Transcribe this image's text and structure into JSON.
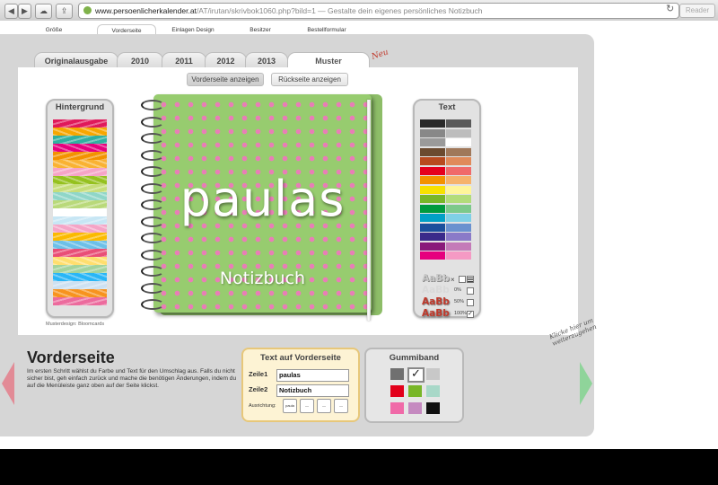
{
  "browser": {
    "url_domain": "www.persoenlicherkalender.at",
    "url_path": "/AT/irutan/skrivbok1060.php?bild=1",
    "title": "— Gestalte dein eigenes persönliches Notizbuch",
    "reader_label": "Reader",
    "reload_glyph": "↻",
    "back_glyph": "◀",
    "forward_glyph": "▶",
    "cloud_glyph": "☁",
    "share_glyph": "⇪"
  },
  "topnav": [
    {
      "label": "Größe"
    },
    {
      "label": "Vorderseite"
    },
    {
      "label": "Einlagen Design"
    },
    {
      "label": "Besitzer"
    },
    {
      "label": "Bestellformular"
    }
  ],
  "year_tabs": [
    {
      "label": "Originalausgabe"
    },
    {
      "label": "2010"
    },
    {
      "label": "2011"
    },
    {
      "label": "2012"
    },
    {
      "label": "2013"
    },
    {
      "label": "Muster"
    }
  ],
  "new_badge": "Neu",
  "view_buttons": {
    "front": "Vorderseite anzeigen",
    "back": "Rückseite anzeigen"
  },
  "background_panel": {
    "title": "Hintergrund",
    "patterns": [
      "#e0195a",
      "#f7a600",
      "#2fb0a0",
      "#e6007e",
      "#f39200",
      "#f9b233",
      "#f5a4c6",
      "#95c11f",
      "#c6dd7a",
      "#8fd6c8",
      "#b9d97a",
      "#ffffff",
      "#c7e6f4",
      "#f5a4c6",
      "#fbba00",
      "#6cc0e8",
      "#e94e77",
      "#ffde6e",
      "#a3d39c",
      "#29b6f6",
      "#cde1f2",
      "#f7931e",
      "#ec6b9d"
    ],
    "credit": "Musterdesign: Bloomcards"
  },
  "notebook": {
    "line1": "paulas",
    "line2": "Notizbuch",
    "background_color": "#97cc6f",
    "dot_color": "#e87eb6",
    "text_color": "#ffffff"
  },
  "text_panel": {
    "title": "Text",
    "colors": [
      [
        "#2a2a2a",
        "#5a5a5a"
      ],
      [
        "#888888",
        "#bdbdbd"
      ],
      [
        "#9a9a9a",
        "#ffffff"
      ],
      [
        "#6b4a2f",
        "#a0785a"
      ],
      [
        "#b84a1f",
        "#e08a5a"
      ],
      [
        "#e5001e",
        "#f06a6a"
      ],
      [
        "#f39200",
        "#f6b26b"
      ],
      [
        "#f7e100",
        "#fff59a"
      ],
      [
        "#78b628",
        "#b2dc7a"
      ],
      [
        "#009a3e",
        "#7cc98a"
      ],
      [
        "#00a0c6",
        "#7fd0e6"
      ],
      [
        "#1b4f9c",
        "#6a91cf"
      ],
      [
        "#3a2a8a",
        "#8a7ac8"
      ],
      [
        "#8a1a7a",
        "#c47ab8"
      ],
      [
        "#e6007e",
        "#f59ac4"
      ]
    ],
    "styles": [
      {
        "sample": "AaBb",
        "value": "×",
        "checked": false,
        "swatch": true
      },
      {
        "sample": "AaBb",
        "value": "0%",
        "checked": false
      },
      {
        "sample": "AaBb",
        "value": "50%",
        "checked": false
      },
      {
        "sample": "AaBb",
        "value": "100%",
        "checked": true
      }
    ]
  },
  "bottom": {
    "title": "Vorderseite",
    "description": "Im ersten Schritt wählst du Farbe und Text für den Umschlag aus. Falls du nicht sicher bist, geh einfach zurück und mache die benötigen Änderungen, indem du auf die Menüleiste ganz oben auf der Seite klickst.",
    "hint": "Klicke hier um weiterzugehen"
  },
  "text_form": {
    "title": "Text auf Vorderseite",
    "row1_label": "Zeile1",
    "row1_value": "paulas",
    "row2_label": "Zeile2",
    "row2_value": "Notizbuch",
    "align_label": "Ausrichtung:",
    "align_options": [
      "paula",
      "—",
      "—",
      "—"
    ]
  },
  "elastic_panel": {
    "title": "Gummiband",
    "colors": [
      "#707070",
      "#ffffff",
      "#c8c8c8",
      "#e2001a",
      "#78b628",
      "#a8d8c8",
      "#f06aa8",
      "#c58ac0",
      "#111111"
    ],
    "selected_index": 1,
    "check_glyph": "✓"
  }
}
